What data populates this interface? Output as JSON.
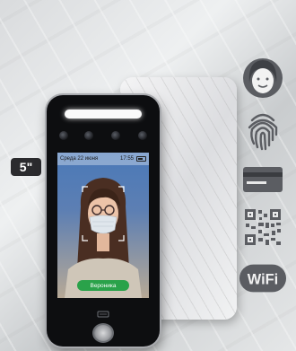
{
  "screen_size_label": "5\"",
  "status_bar": {
    "date": "Среда 22 июня",
    "time": "17:55"
  },
  "recognized_name": "Вероника",
  "features": [
    {
      "icon": "face-recognition-icon"
    },
    {
      "icon": "fingerprint-icon"
    },
    {
      "icon": "rfid-card-icon"
    },
    {
      "icon": "qr-code-icon"
    },
    {
      "icon": "wifi-icon"
    }
  ],
  "wifi_text": "WiFi",
  "colors": {
    "name_pill": "#2aa24a",
    "device_body": "#0d0e10",
    "feature_icon": "#5b5d62"
  }
}
